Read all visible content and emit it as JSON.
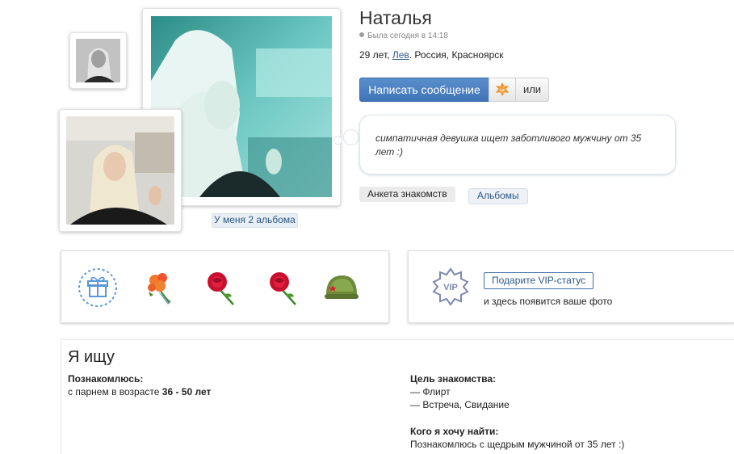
{
  "profile": {
    "name": "Наталья",
    "last_seen": "Была сегодня в 14:18",
    "age": "29 лет,",
    "zodiac": "Лев",
    "location": ". Россия, Красноярск",
    "status_text": "симпатичная девушка ищет заботливого мужчину от 35 лет :)"
  },
  "photos": {
    "albums_link": "У меня 2 альбома"
  },
  "actions": {
    "message_label": "Написать сообщение",
    "vip_icon": "vip-sun-icon",
    "or_label": "или"
  },
  "tabs": {
    "anketa": "Анкета знакомств",
    "albums": "Альбомы"
  },
  "gifts": {
    "items": [
      "gift-box-icon",
      "flower-bouquet-icon",
      "red-rose-icon",
      "red-rose-icon",
      "army-helmet-icon"
    ]
  },
  "vip": {
    "badge_text": "VIP",
    "button_label": "Подарите VIP-статус",
    "hint": "и здесь появится ваше фото"
  },
  "seeking": {
    "title": "Я ищу",
    "meet_label": "Познакомлюсь:",
    "meet_prefix": "с парнем в возрасте ",
    "meet_range": "36 - 50 лет",
    "goal_label": "Цель знакомства:",
    "goals": [
      "— Флирт",
      "— Встреча, Свидание"
    ],
    "whom_label": "Кого я хочу найти:",
    "whom_value": "Познакомлюсь с щедрым мужчиной от 35 лет :)"
  },
  "colors": {
    "accent": "#3f74b8",
    "link": "#2a5885"
  }
}
